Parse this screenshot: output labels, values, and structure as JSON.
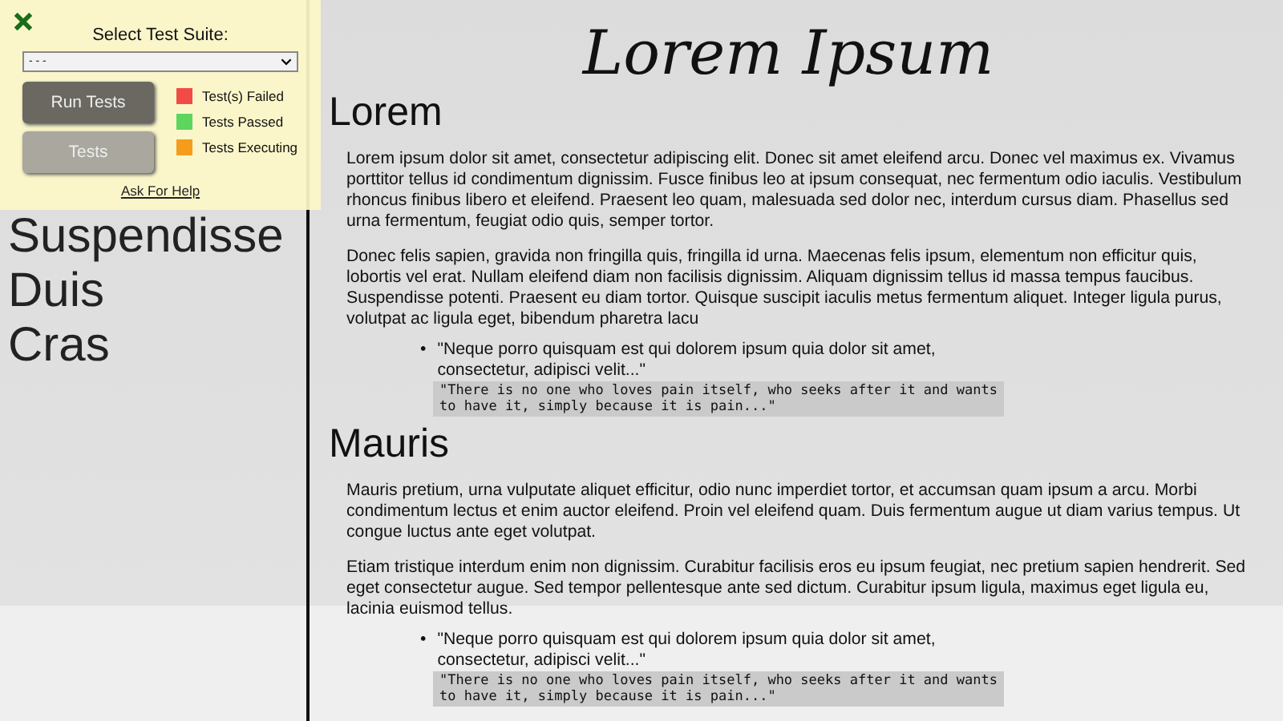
{
  "title": "Lorem Ipsum",
  "sidebar": {
    "items": [
      "Suspendisse",
      "Duis",
      "Cras"
    ]
  },
  "test_panel": {
    "label": "Select Test Suite:",
    "select_value": "- - -",
    "buttons": [
      {
        "label": "Run Tests",
        "disabled": false
      },
      {
        "label": "Tests",
        "disabled": true
      }
    ],
    "legend": [
      {
        "label": "Test(s) Failed",
        "color": "#f04c45"
      },
      {
        "label": "Tests Passed",
        "color": "#5cd65c"
      },
      {
        "label": "Tests Executing",
        "color": "#f59c1a"
      }
    ],
    "help_link": "Ask For Help"
  },
  "sections": [
    {
      "heading": "Lorem",
      "paragraphs": [
        "Lorem ipsum dolor sit amet, consectetur adipiscing elit. Donec sit amet eleifend arcu. Donec vel maximus ex. Vivamus porttitor tellus id condimentum dignissim. Fusce finibus leo at ipsum consequat, nec fermentum odio iaculis. Vestibulum rhoncus finibus libero et eleifend. Praesent leo quam, malesuada sed dolor nec, interdum cursus diam. Phasellus sed urna fermentum, feugiat odio quis, semper tortor.",
        "Donec felis sapien, gravida non fringilla quis, fringilla id urna. Maecenas felis ipsum, elementum non efficitur quis, lobortis vel erat. Nullam eleifend diam non facilisis dignissim. Aliquam dignissim tellus id massa tempus faucibus. Suspendisse potenti. Praesent eu diam tortor. Quisque suscipit iaculis metus fermentum aliquet. Integer ligula purus, volutpat ac ligula eget, bibendum pharetra lacu"
      ],
      "marker": "•",
      "quote": "\"Neque porro quisquam est qui dolorem ipsum quia dolor sit amet, consectetur, adipisci velit...\"",
      "code": "\"There is no one who loves pain itself, who seeks after it and wants\nto have it, simply because it is pain...\""
    },
    {
      "heading": "Mauris",
      "paragraphs": [
        "Mauris pretium, urna vulputate aliquet efficitur, odio nunc imperdiet tortor, et accumsan quam ipsum a arcu. Morbi condimentum lectus et enim auctor eleifend. Proin vel eleifend quam. Duis fermentum augue ut diam varius tempus. Ut congue luctus ante eget volutpat.",
        "Etiam tristique interdum enim non dignissim. Curabitur facilisis eros eu ipsum feugiat, nec pretium sapien hendrerit. Sed eget consectetur augue. Sed tempor pellentesque ante sed dictum. Curabitur ipsum ligula, maximus eget ligula eu, lacinia euismod tellus."
      ],
      "marker": "•",
      "quote": "\"Neque porro quisquam est qui dolorem ipsum quia dolor sit amet, consectetur, adipisci velit...\"",
      "code": "\"There is no one who loves pain itself, who seeks after it and wants\nto have it, simply because it is pain...\""
    }
  ]
}
